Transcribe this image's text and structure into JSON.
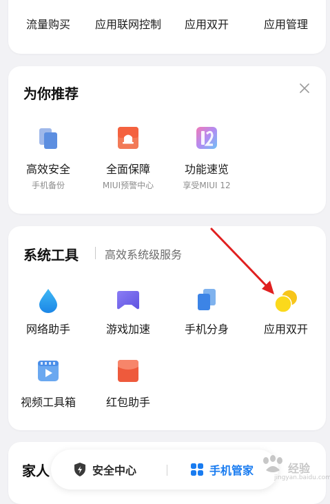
{
  "top_row": {
    "items": [
      {
        "label": "流量购买"
      },
      {
        "label": "应用联网控制"
      },
      {
        "label": "应用双开"
      },
      {
        "label": "应用管理"
      }
    ]
  },
  "recommend": {
    "title": "为你推荐",
    "items": [
      {
        "label": "高效安全",
        "sub": "手机备份",
        "icon": "backup-icon"
      },
      {
        "label": "全面保障",
        "sub": "MIUI预警中心",
        "icon": "alert-center-icon"
      },
      {
        "label": "功能速览",
        "sub": "享受MIUI 12",
        "icon": "miui12-icon"
      }
    ]
  },
  "system_tools": {
    "title": "系统工具",
    "subtitle": "高效系统级服务",
    "items": [
      {
        "label": "网络助手",
        "icon": "water-drop-icon"
      },
      {
        "label": "游戏加速",
        "icon": "gamepad-icon"
      },
      {
        "label": "手机分身",
        "icon": "phone-clone-icon"
      },
      {
        "label": "应用双开",
        "icon": "dual-apps-icon"
      },
      {
        "label": "视频工具箱",
        "icon": "video-toolbox-icon"
      },
      {
        "label": "红包助手",
        "icon": "red-envelope-icon"
      }
    ]
  },
  "family": {
    "title": "家人"
  },
  "bottom_nav": {
    "tabs": [
      {
        "label": "安全中心",
        "icon": "shield-icon"
      },
      {
        "label": "手机管家",
        "icon": "grid-icon"
      }
    ]
  },
  "watermark": {
    "text": "经验",
    "url": "jingyan.baidu.com"
  },
  "colors": {
    "accent_blue": "#1a7cf0",
    "annotation_red": "#e02020",
    "background": "#f2f2f5",
    "card": "#ffffff"
  }
}
